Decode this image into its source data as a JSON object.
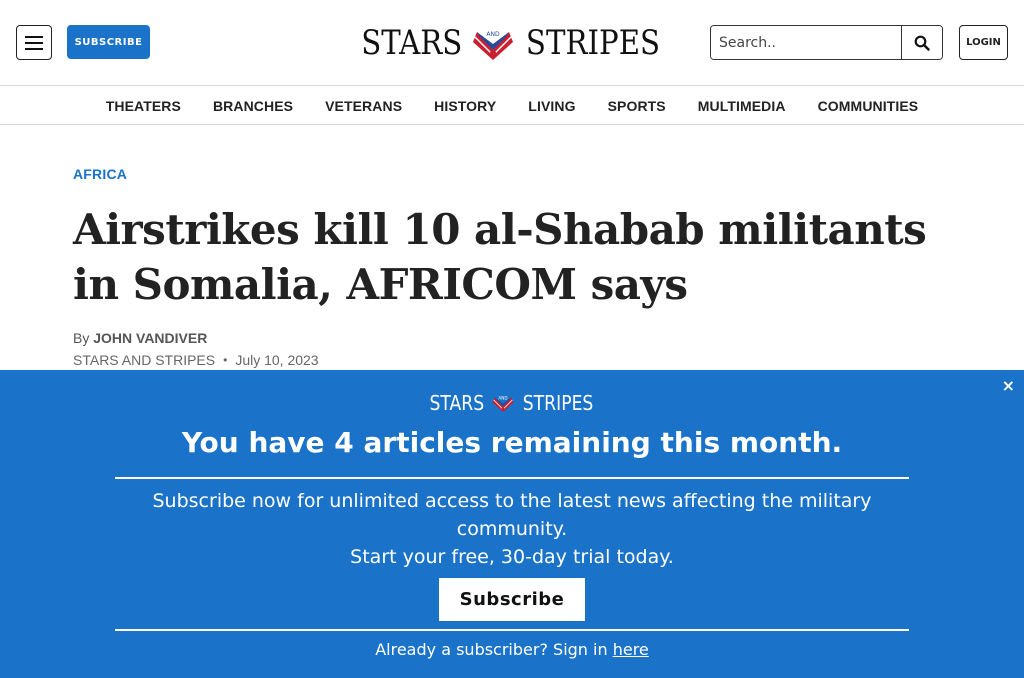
{
  "header": {
    "menu_icon": "hamburger-icon",
    "subscribe_label": "SUBSCRIBE",
    "logo_left": "STARS",
    "logo_right": "STRIPES",
    "logo_mid": "AND",
    "search_placeholder": "Search..",
    "search_icon": "search-icon",
    "login_label": "LOGIN"
  },
  "nav": {
    "items": [
      "THEATERS",
      "BRANCHES",
      "VETERANS",
      "HISTORY",
      "LIVING",
      "SPORTS",
      "MULTIMEDIA",
      "COMMUNITIES"
    ]
  },
  "article": {
    "kicker": "AFRICA",
    "headline": "Airstrikes kill 10 al-Shabab militants in Somalia, AFRICOM says",
    "by": "By",
    "author": "JOHN VANDIVER",
    "source": "STARS AND STRIPES",
    "dot": "•",
    "date": "July 10, 2023"
  },
  "paywall": {
    "close": "×",
    "logo_left": "STARS",
    "logo_right": "STRIPES",
    "logo_mid": "AND",
    "title": "You have 4 articles remaining this month.",
    "body_line1": "Subscribe now for unlimited access to the latest news affecting the military community.",
    "body_line2": "Start your free, 30-day trial today.",
    "subscribe_label": "Subscribe",
    "signin_text": "Already a subscriber? Sign in",
    "signin_link": "here"
  },
  "colors": {
    "brand_blue": "#1a73c9",
    "text_dark": "#222222"
  }
}
